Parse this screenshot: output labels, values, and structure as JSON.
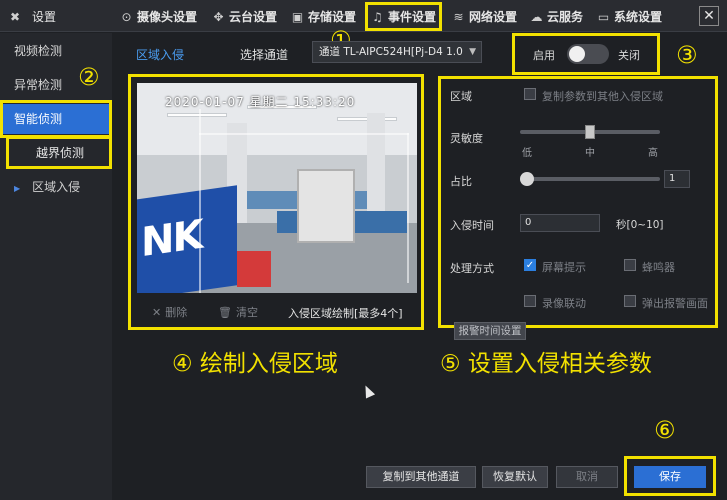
{
  "window": {
    "title": "设置",
    "close_symbol": "✕"
  },
  "top_tabs": [
    {
      "label": "摄像头设置",
      "icon": "camera-icon",
      "glyph": "⊙"
    },
    {
      "label": "云台设置",
      "icon": "ptz-icon",
      "glyph": "✥"
    },
    {
      "label": "存储设置",
      "icon": "save-icon",
      "glyph": "▣"
    },
    {
      "label": "事件设置",
      "icon": "bell-icon",
      "glyph": "♫"
    },
    {
      "label": "网络设置",
      "icon": "wifi-icon",
      "glyph": "≋"
    },
    {
      "label": "云服务",
      "icon": "cloud-icon",
      "glyph": "☁"
    },
    {
      "label": "系统设置",
      "icon": "monitor-icon",
      "glyph": "▭"
    }
  ],
  "sidebar": {
    "items": [
      "视频检测",
      "异常检测",
      "智能侦测"
    ],
    "sub_item": "越界侦测",
    "tree_item": "区域入侵"
  },
  "main": {
    "section_tab": "区域入侵",
    "channel_label": "选择通道",
    "channel_value": "通道 TL-AIPC524H[Pj-D4 1.0",
    "enable_label": "启用",
    "disable_label": "关闭",
    "enabled": false
  },
  "video": {
    "osd": "2020-01-07 星期二 15:33:20",
    "banner": "NK",
    "tools": {
      "delete": "删除",
      "clear": "清空",
      "draw_note": "入侵区域绘制[最多4个]"
    }
  },
  "annotations": {
    "markers": [
      "①",
      "②",
      "③",
      "④",
      "⑤",
      "⑥"
    ],
    "caption4": "④ 绘制入侵区域",
    "caption5": "⑤ 设置入侵相关参数"
  },
  "params": {
    "region_label": "区域",
    "copy_label": "复制参数到其他入侵区域",
    "sensitivity_label": "灵敏度",
    "sensitivity_ticks": [
      "低",
      "中",
      "高"
    ],
    "sensitivity_level": "中",
    "ratio_label": "占比",
    "ratio_value": "1",
    "intrusion_time_label": "入侵时间",
    "intrusion_time_value": "0",
    "intrusion_time_hint": "秒[0~10]",
    "handling_label": "处理方式",
    "actions": [
      {
        "label": "屏幕提示",
        "checked": true
      },
      {
        "label": "蜂鸣器",
        "checked": false
      },
      {
        "label": "录像联动",
        "checked": false
      },
      {
        "label": "弹出报警画面",
        "checked": false
      }
    ],
    "schedule_button": "报警时间设置"
  },
  "footer": {
    "copy_button": "复制到其他通道",
    "restore_button": "恢复默认",
    "cancel_button": "取消",
    "save_button": "保存"
  },
  "colors": {
    "highlight": "#f2e100",
    "accent": "#2b6fd4",
    "background": "#1e2024"
  }
}
